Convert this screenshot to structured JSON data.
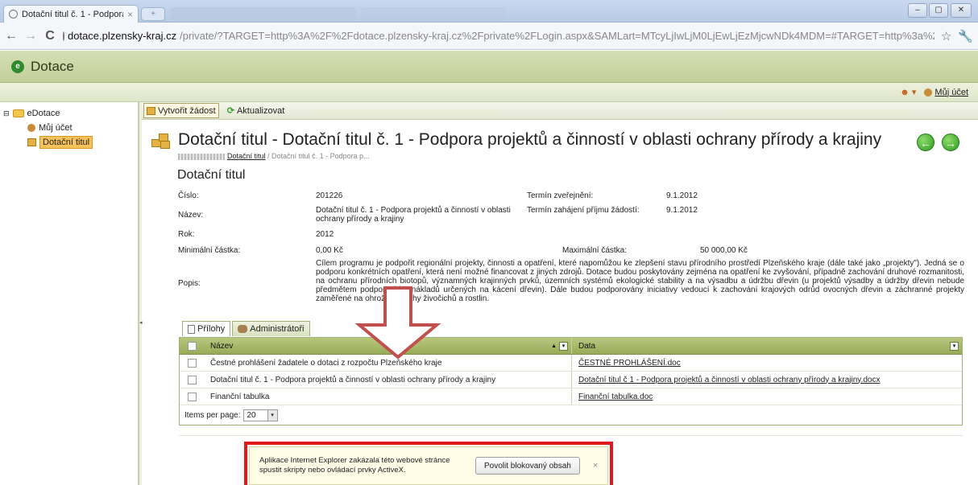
{
  "browser": {
    "tab_title": "Dotační titul č. 1 - Podpora",
    "tab_close": "×",
    "newtab_symbol": "+",
    "url_host": "dotace.plzensky-kraj.cz",
    "url_path": "/private/?TARGET=http%3A%2F%2Fdotace.plzensky-kraj.cz%2Fprivate%2FLogin.aspx&SAMLart=MTcyLjIwLjM0LjEwLjEzMjcwNDk4MDM=#TARGET=http%3a%2f%2fdota",
    "back_symbol": "←",
    "forward_symbol": "→",
    "reload_symbol": "C",
    "star_symbol": "☆",
    "wrench_symbol": "🔧",
    "min_symbol": "–",
    "max_symbol": "▢",
    "close_symbol": "✕"
  },
  "app": {
    "title": "Dotace",
    "logo_letter": "e",
    "user_link": "Můj účet",
    "help_symbol": "☻ ▾"
  },
  "tree": {
    "root": "eDotace",
    "items": [
      {
        "label": "Můj účet"
      },
      {
        "label": "Dotační titul"
      }
    ]
  },
  "toolbar": {
    "create_label": "Vytvořit žádost",
    "refresh_label": "Aktualizovat"
  },
  "page": {
    "title": "Dotační titul - Dotační titul č. 1 - Podpora projektů a činností v oblasti ochrany přírody a krajiny",
    "breadcrumb_link": "Dotační titul",
    "breadcrumb_sep": " / ",
    "breadcrumb_current": "Dotační titul č. 1 - Podpora p...",
    "section_title": "Dotační titul",
    "prev_symbol": "←",
    "next_symbol": "→"
  },
  "fields": {
    "cislo_label": "Číslo:",
    "cislo_value": "201226",
    "nazev_label": "Název:",
    "nazev_value": "Dotační titul č. 1 - Podpora projektů a činností v oblasti ochrany přírody a krajiny",
    "rok_label": "Rok:",
    "rok_value": "2012",
    "min_label": "Minimální částka:",
    "min_value": "0,00 Kč",
    "max_label": "Maximální částka:",
    "max_value": "50 000,00 Kč",
    "popis_label": "Popis:",
    "popis_value": "Cílem programu je podpořit regionální projekty, činnosti a opatření, které napomůžou ke zlepšení stavu přírodního prostředí Plzeňského kraje (dále také jako „projekty\"). Jedná se o podporu konkrétních opatření, která není možné financovat z jiných zdrojů. Dotace budou poskytovány zejména na opatření ke zvyšování, případně zachování druhové rozmanitosti, na ochranu přírodních biotopů, významných krajinných prvků, územních systémů ekologické stability a na výsadbu a údržbu dřevin (u projektů výsadby a údržby dřevin nebude předmětem podpory část nákladů určených na kácení dřevin). Dále budou podporovány iniciativy vedoucí k zachování krajových odrůd ovocných dřevin a záchranné projekty zaměřené na ohrožené druhy živočichů a rostlin.",
    "zverejneni_label": "Termín zveřejnění:",
    "zverejneni_value": "9.1.2012",
    "zahajeni_label": "Termín zahájení příjmu žádostí:",
    "zahajeni_value": "9.1.2012"
  },
  "tabs": [
    {
      "label": "Přílohy"
    },
    {
      "label": "Administrátoři"
    }
  ],
  "grid": {
    "columns": [
      "Název",
      "Data"
    ],
    "sort_symbol": "▲",
    "dropdown_symbol": "▾",
    "rows": [
      {
        "name": "Čestné prohlášení žadatele o dotaci z rozpočtu Plzeňského kraje",
        "data": "ČESTNÉ PROHLÁŠENÍ.doc"
      },
      {
        "name": "Dotační titul č. 1 - Podpora projektů a činností v oblasti ochrany přírody a krajiny",
        "data": "Dotační titul č 1 - Podpora projektů a činností v oblasti ochrany přírody a krajiny.docx"
      },
      {
        "name": "Finanční tabulka",
        "data": "Finanční tabulka.doc"
      }
    ],
    "items_per_page_label": "Items per page:",
    "items_per_page_value": "20"
  },
  "infobar": {
    "message": "Aplikace Internet Explorer zakázala této webové stránce spustit skripty nebo ovládací prvky ActiveX.",
    "button_label": "Povolit blokovaný obsah",
    "close_symbol": "×"
  },
  "colors": {
    "header_green": "#c2cf9a",
    "grid_header": "#98ab57",
    "highlight_red": "#e0181b",
    "arrow_red": "#c0504d",
    "selection_orange": "#f7c25a"
  }
}
